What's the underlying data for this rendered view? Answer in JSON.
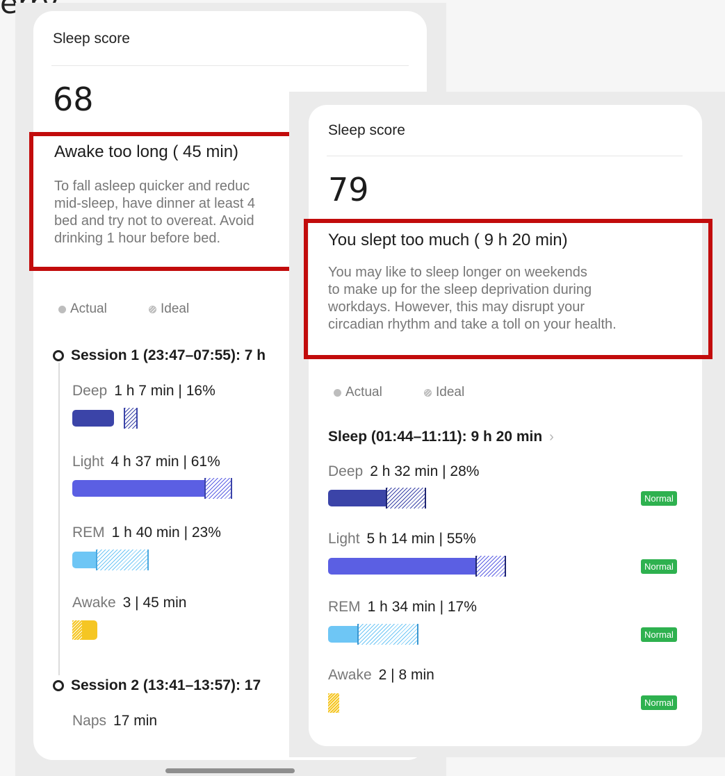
{
  "top_cut_text": "erry",
  "left_card": {
    "header": "Sleep score",
    "score": "68",
    "message_title": "Awake too long ( 45 min)",
    "message_lines": [
      "To fall asleep quicker and reduc",
      "mid-sleep, have dinner at least 4",
      "bed and try not to overeat. Avoid",
      "drinking 1 hour before bed."
    ],
    "legend": {
      "actual": "Actual",
      "ideal": "Ideal"
    },
    "session1_label": "Session 1 (23:47–07:55):  7 h",
    "stages": [
      {
        "name": "Deep",
        "value": "1 h 7 min | 16%"
      },
      {
        "name": "Light",
        "value": "4 h 37 min | 61%"
      },
      {
        "name": "REM",
        "value": "1 h 40 min | 23%"
      },
      {
        "name": "Awake",
        "value": "3 |  45 min"
      }
    ],
    "session2_label": "Session 2 (13:41–13:57):  17",
    "naps": {
      "name": "Naps",
      "value": "17 min"
    }
  },
  "right_card": {
    "header": "Sleep score",
    "score": "79",
    "message_title": "You slept too much ( 9 h 20 min)",
    "message_lines": [
      "You may like to sleep longer on weekends",
      "to make up for the sleep deprivation during",
      "workdays. However, this may disrupt your",
      "circadian rhythm and take a toll on your health."
    ],
    "legend": {
      "actual": "Actual",
      "ideal": "Ideal"
    },
    "session_label": "Sleep (01:44–11:11):  9 h 20 min",
    "stages": [
      {
        "name": "Deep",
        "value": "2 h 32 min | 28%",
        "badge": "Normal"
      },
      {
        "name": "Light",
        "value": "5 h 14 min | 55%",
        "badge": "Normal"
      },
      {
        "name": "REM",
        "value": "1 h 34 min | 17%",
        "badge": "Normal"
      },
      {
        "name": "Awake",
        "value": "2 |  8 min",
        "badge": "Normal"
      }
    ]
  },
  "colors": {
    "deep": "#3b44a8",
    "light": "#5b5fe3",
    "rem": "#6ec6f5",
    "awake": "#f5c623",
    "highlight": "#c20c0c",
    "badge": "#2eb14f"
  }
}
